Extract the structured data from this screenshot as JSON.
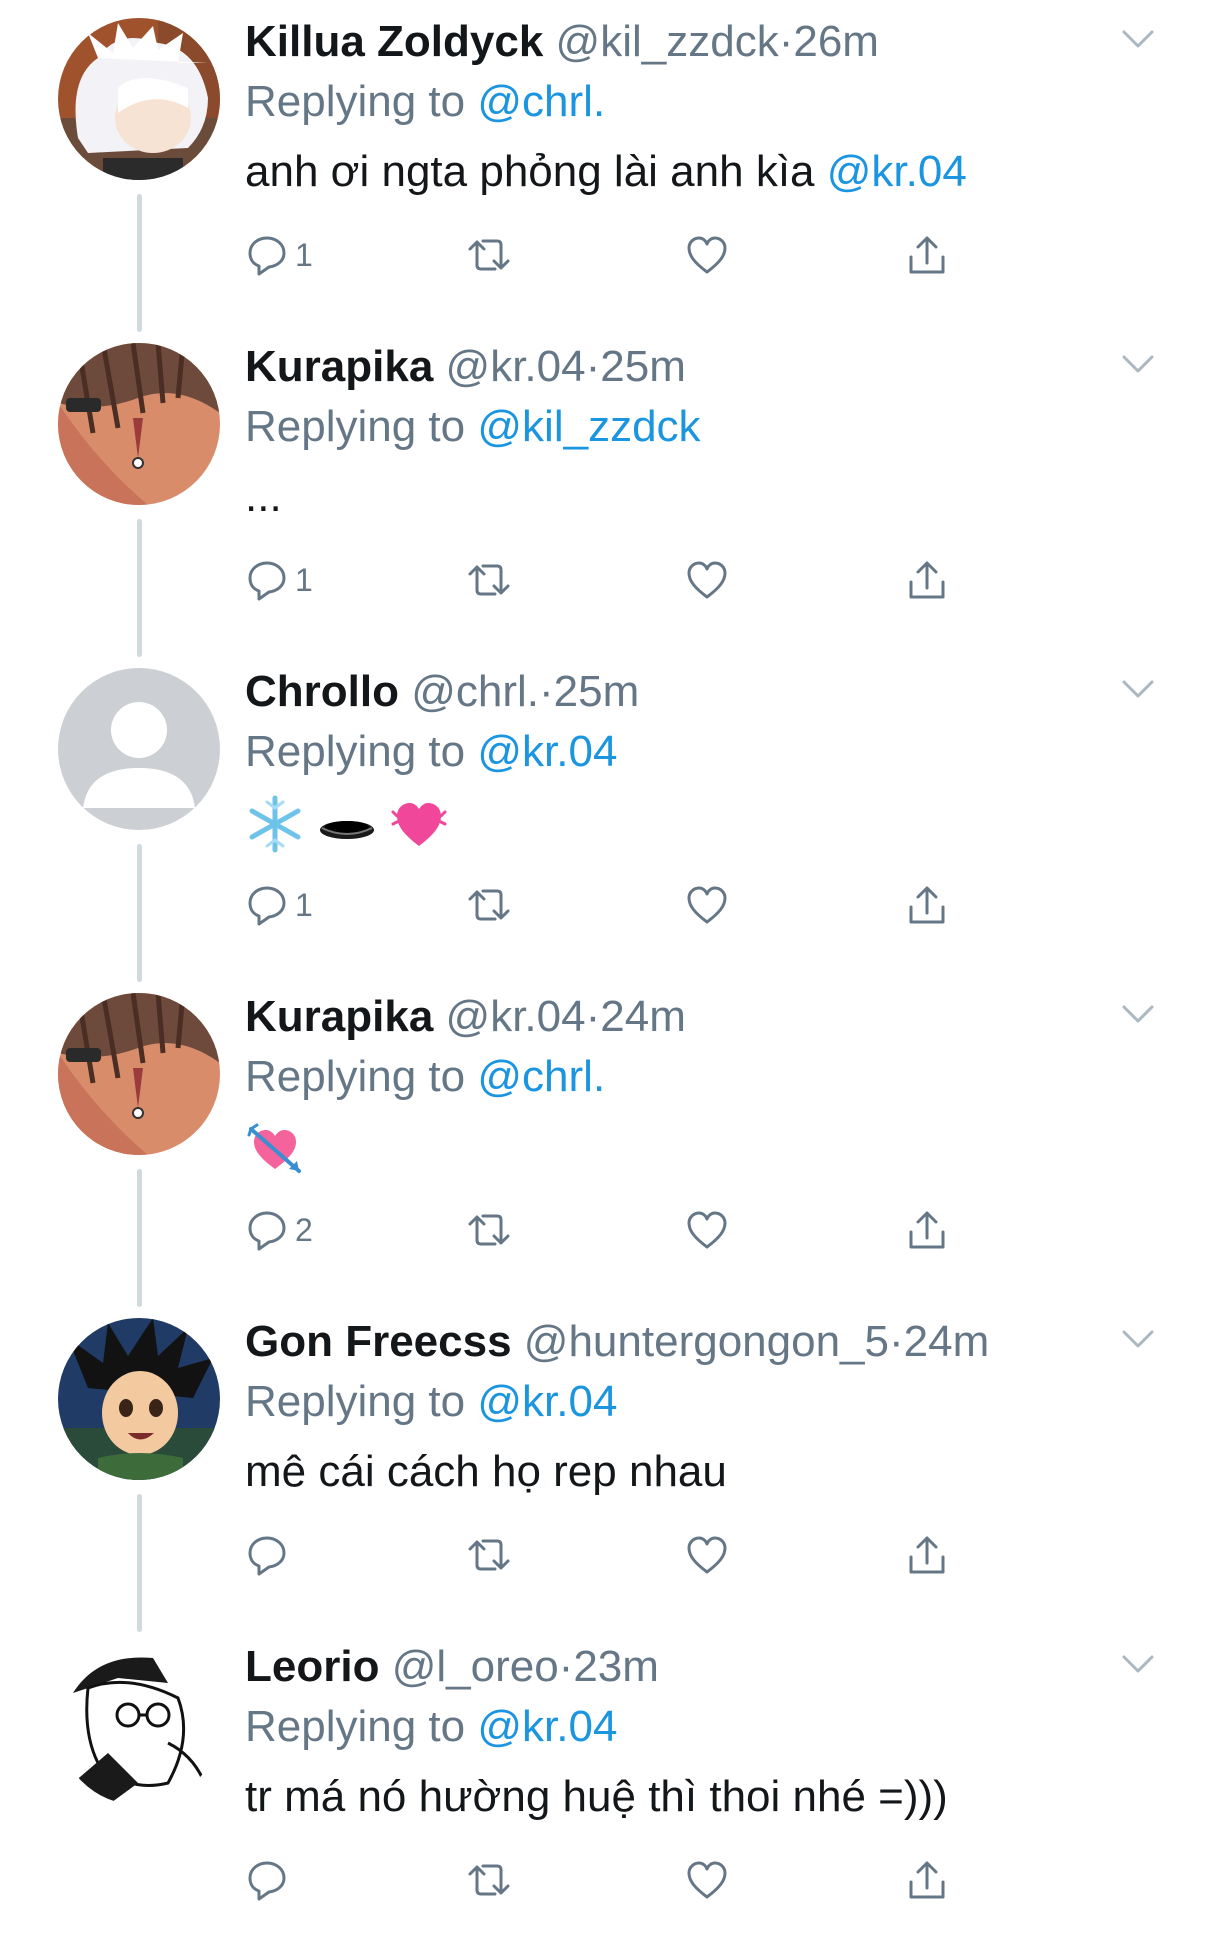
{
  "tweets": [
    {
      "name": "Killua Zoldyck",
      "handle": "@kil_zzdck",
      "time": "26m",
      "replying_label": "Replying to",
      "replying_to": "@chrl.",
      "text": "anh ơi ngta phỏng lài anh kìa ",
      "text_mention": "@kr.04",
      "reply_count": "1",
      "avatar": "killua-avatar"
    },
    {
      "name": "Kurapika",
      "handle": "@kr.04",
      "time": "25m",
      "replying_label": "Replying to",
      "replying_to": "@kil_zzdck",
      "text": "...",
      "text_mention": "",
      "reply_count": "1",
      "avatar": "kurapika-avatar"
    },
    {
      "name": "Chrollo",
      "handle": "@chrl.",
      "time": "25m",
      "replying_label": "Replying to",
      "replying_to": "@kr.04",
      "text": "",
      "text_mention": "",
      "emojis": [
        "snowflake-emoji",
        "hole-emoji",
        "beating-heart-emoji"
      ],
      "reply_count": "1",
      "avatar": "default-avatar"
    },
    {
      "name": "Kurapika",
      "handle": "@kr.04",
      "time": "24m",
      "replying_label": "Replying to",
      "replying_to": "@chrl.",
      "text": "",
      "text_mention": "",
      "emojis": [
        "heart-with-arrow-emoji"
      ],
      "reply_count": "2",
      "avatar": "kurapika-avatar"
    },
    {
      "name": "Gon Freecss",
      "handle": "@huntergongon_5",
      "time": "24m",
      "replying_label": "Replying to",
      "replying_to": "@kr.04",
      "text": "mê cái cách họ rep nhau",
      "text_mention": "",
      "reply_count": "",
      "avatar": "gon-avatar"
    },
    {
      "name": "Leorio",
      "handle": "@l_oreo",
      "time": "23m",
      "replying_label": "Replying to",
      "replying_to": "@kr.04",
      "text": "tr má nó hường huệ thì thoi nhé =)))",
      "text_mention": "",
      "reply_count": "",
      "avatar": "leorio-avatar"
    }
  ],
  "separator": "·",
  "colors": {
    "name": "#14171a",
    "meta": "#657786",
    "mention": "#1b95e0",
    "thread_line": "#cfd9de"
  }
}
